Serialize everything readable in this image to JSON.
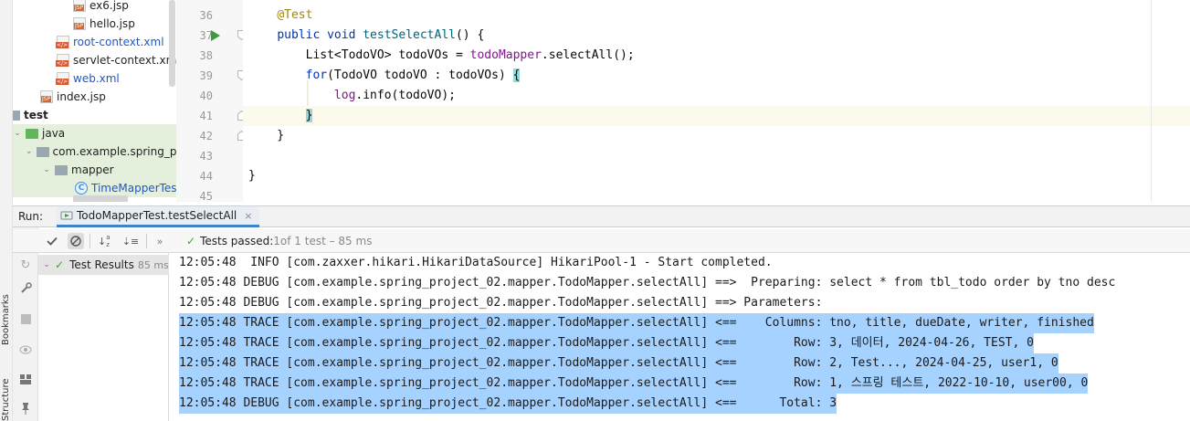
{
  "side_labels": {
    "bookmarks": "Bookmarks",
    "structure": "Structure"
  },
  "project_tree": {
    "items": [
      {
        "label": "ex6.jsp",
        "icon": "jsp-file-icon"
      },
      {
        "label": "hello.jsp",
        "icon": "jsp-file-icon"
      },
      {
        "label": "root-context.xml",
        "icon": "xml-file-icon"
      },
      {
        "label": "servlet-context.xml",
        "icon": "xml-file-icon"
      },
      {
        "label": "web.xml",
        "icon": "xml-file-icon"
      },
      {
        "label": "index.jsp",
        "icon": "jsp-file-icon"
      },
      {
        "label": "test",
        "icon": "folder-icon"
      },
      {
        "label": "java",
        "icon": "source-folder-icon"
      },
      {
        "label": "com.example.spring_pro",
        "icon": "package-icon"
      },
      {
        "label": "mapper",
        "icon": "package-icon"
      },
      {
        "label": "TimeMapperTest",
        "icon": "test-class-icon"
      }
    ]
  },
  "editor": {
    "line_numbers": [
      "36",
      "37",
      "38",
      "39",
      "40",
      "41",
      "42",
      "43",
      "44",
      "45"
    ],
    "lines": [
      {
        "tokens": [
          {
            "t": "    "
          },
          {
            "t": "@Test",
            "c": "ann"
          }
        ]
      },
      {
        "tokens": [
          {
            "t": "    "
          },
          {
            "t": "public void ",
            "c": "kw"
          },
          {
            "t": "testSelectAll",
            "c": "fn"
          },
          {
            "t": "() {"
          }
        ]
      },
      {
        "tokens": [
          {
            "t": "        List<TodoVO> todoVOs = "
          },
          {
            "t": "todoMapper",
            "c": "fld"
          },
          {
            "t": ".selectAll();"
          }
        ]
      },
      {
        "tokens": [
          {
            "t": "        "
          },
          {
            "t": "for",
            "c": "kw"
          },
          {
            "t": "(TodoVO todoVO : todoVOs) "
          },
          {
            "t": "{",
            "c": "brace-hl"
          }
        ]
      },
      {
        "tokens": [
          {
            "t": "            "
          },
          {
            "t": "log",
            "c": "fld"
          },
          {
            "t": ".info(todoVO);"
          }
        ]
      },
      {
        "tokens": [
          {
            "t": "        "
          },
          {
            "t": "}",
            "c": "brace-hl"
          }
        ]
      },
      {
        "tokens": [
          {
            "t": "    }"
          }
        ]
      },
      {
        "tokens": [
          {
            "t": ""
          }
        ]
      },
      {
        "tokens": [
          {
            "t": "}"
          }
        ]
      },
      {
        "tokens": [
          {
            "t": ""
          }
        ]
      }
    ]
  },
  "run_panel": {
    "label": "Run:",
    "tab_title": "TodoMapperTest.testSelectAll",
    "tab_close": "×",
    "status": {
      "prefix": "Tests passed: ",
      "count": "1",
      "suffix": " of 1 test – 85 ms"
    },
    "results_root": {
      "label": "Test Results",
      "time": "85 ms"
    }
  },
  "console": {
    "lines": [
      {
        "text": "12:05:48  INFO [com.zaxxer.hikari.HikariDataSource] HikariPool-1 - Start completed.",
        "selected": false
      },
      {
        "text": "12:05:48 DEBUG [com.example.spring_project_02.mapper.TodoMapper.selectAll] ==>  Preparing: select * from tbl_todo order by tno desc",
        "selected": false
      },
      {
        "text": "12:05:48 DEBUG [com.example.spring_project_02.mapper.TodoMapper.selectAll] ==> Parameters: ",
        "selected": false
      },
      {
        "text": "12:05:48 TRACE [com.example.spring_project_02.mapper.TodoMapper.selectAll] <==    Columns: tno, title, dueDate, writer, finished",
        "selected": true
      },
      {
        "text": "12:05:48 TRACE [com.example.spring_project_02.mapper.TodoMapper.selectAll] <==        Row: 3, 데이터, 2024-04-26, TEST, 0",
        "selected": true
      },
      {
        "text": "12:05:48 TRACE [com.example.spring_project_02.mapper.TodoMapper.selectAll] <==        Row: 2, Test..., 2024-04-25, user1, 0",
        "selected": true
      },
      {
        "text": "12:05:48 TRACE [com.example.spring_project_02.mapper.TodoMapper.selectAll] <==        Row: 1, 스프링 테스트, 2022-10-10, user00, 0",
        "selected": true
      },
      {
        "text": "12:05:48 DEBUG [com.example.spring_project_02.mapper.TodoMapper.selectAll] <==      Total: 3",
        "selected": true
      }
    ]
  },
  "colors": {
    "selection": "#a6d2ff",
    "accent": "#4083c9",
    "pass": "#4c9b3c"
  }
}
